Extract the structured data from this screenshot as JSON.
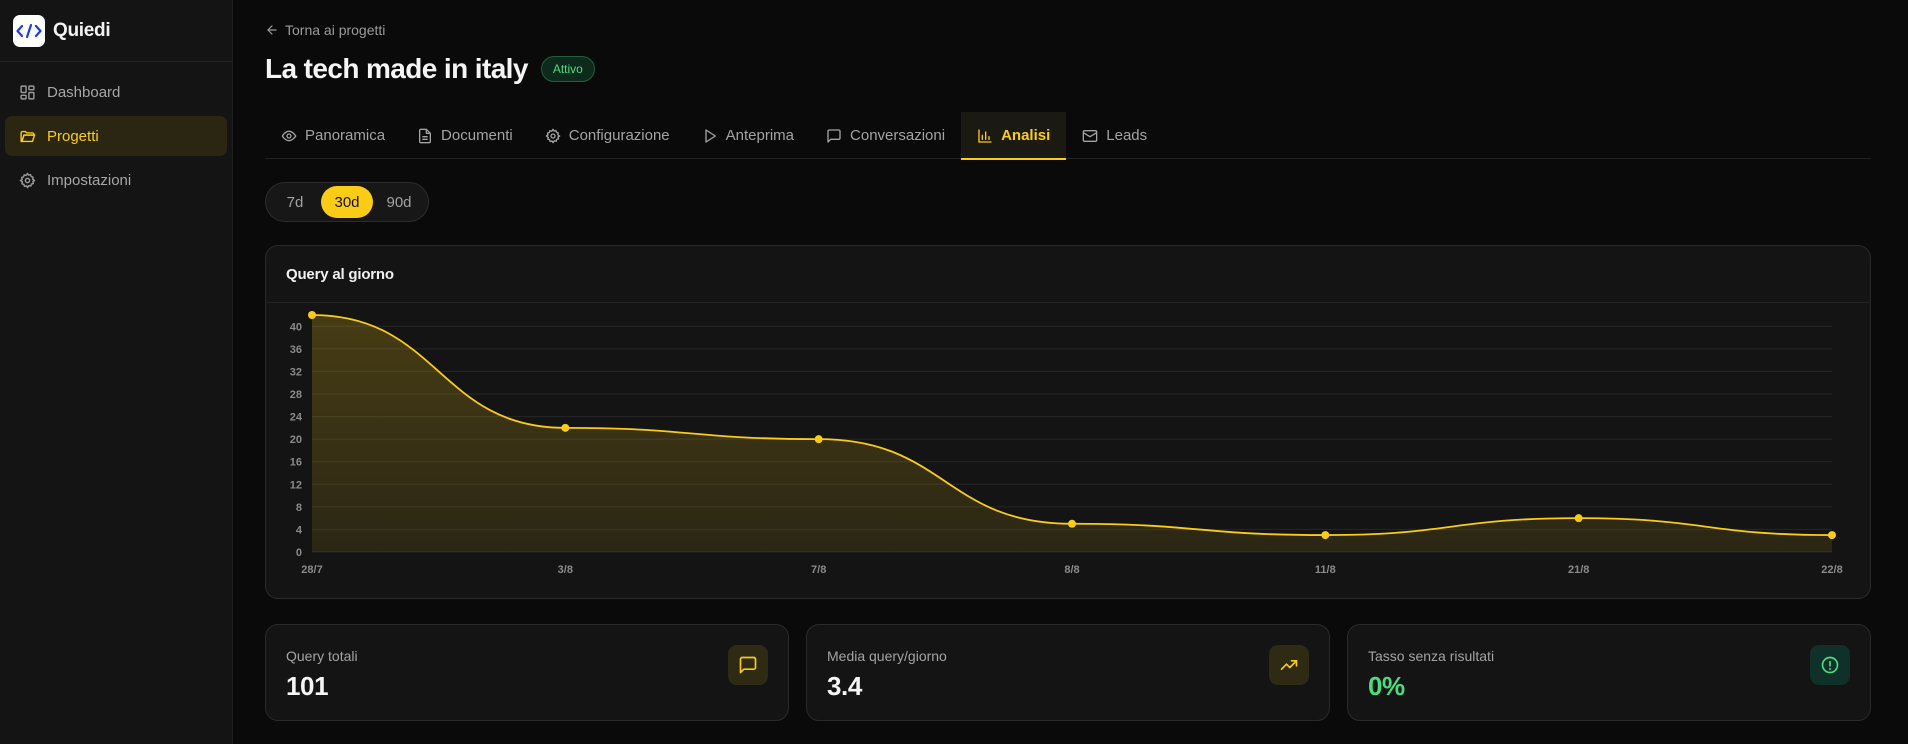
{
  "app": {
    "name": "Quiedi"
  },
  "sidebar": {
    "items": [
      {
        "label": "Dashboard",
        "icon": "dashboard-icon",
        "active": false
      },
      {
        "label": "Progetti",
        "icon": "folder-icon",
        "active": true
      },
      {
        "label": "Impostazioni",
        "icon": "gear-icon",
        "active": false
      }
    ]
  },
  "header": {
    "back_label": "Torna ai progetti",
    "title": "La tech made in italy",
    "status": "Attivo"
  },
  "tabs": [
    {
      "label": "Panoramica",
      "icon": "eye-icon"
    },
    {
      "label": "Documenti",
      "icon": "document-icon"
    },
    {
      "label": "Configurazione",
      "icon": "gear-icon"
    },
    {
      "label": "Anteprima",
      "icon": "play-icon"
    },
    {
      "label": "Conversazioni",
      "icon": "chat-icon"
    },
    {
      "label": "Analisi",
      "icon": "bar-chart-icon",
      "active": true
    },
    {
      "label": "Leads",
      "icon": "mail-icon"
    }
  ],
  "range": {
    "options": [
      "7d",
      "30d",
      "90d"
    ],
    "selected": "30d"
  },
  "chart": {
    "title": "Query al giorno"
  },
  "chart_data": {
    "type": "area",
    "title": "Query al giorno",
    "xlabel": "",
    "ylabel": "",
    "categories": [
      "28/7",
      "3/8",
      "7/8",
      "8/8",
      "11/8",
      "21/8",
      "22/8"
    ],
    "values": [
      42,
      22,
      20,
      5,
      3,
      6,
      3
    ],
    "yticks": [
      0,
      4,
      8,
      12,
      16,
      20,
      24,
      28,
      32,
      36,
      40
    ],
    "ylim": [
      0,
      42
    ],
    "grid": true,
    "line_color": "#facc15",
    "fill_color": "#facc15"
  },
  "stats": [
    {
      "label": "Query totali",
      "value": "101",
      "icon": "chat-icon",
      "accent": "#facc15"
    },
    {
      "label": "Media query/giorno",
      "value": "3.4",
      "icon": "trending-up-icon",
      "accent": "#facc15"
    },
    {
      "label": "Tasso senza risultati",
      "value": "0%",
      "icon": "alert-circle-icon",
      "accent": "#4ade80"
    }
  ],
  "colors": {
    "accent": "#facc15",
    "success": "#4ade80",
    "background": "#0a0a0a"
  }
}
